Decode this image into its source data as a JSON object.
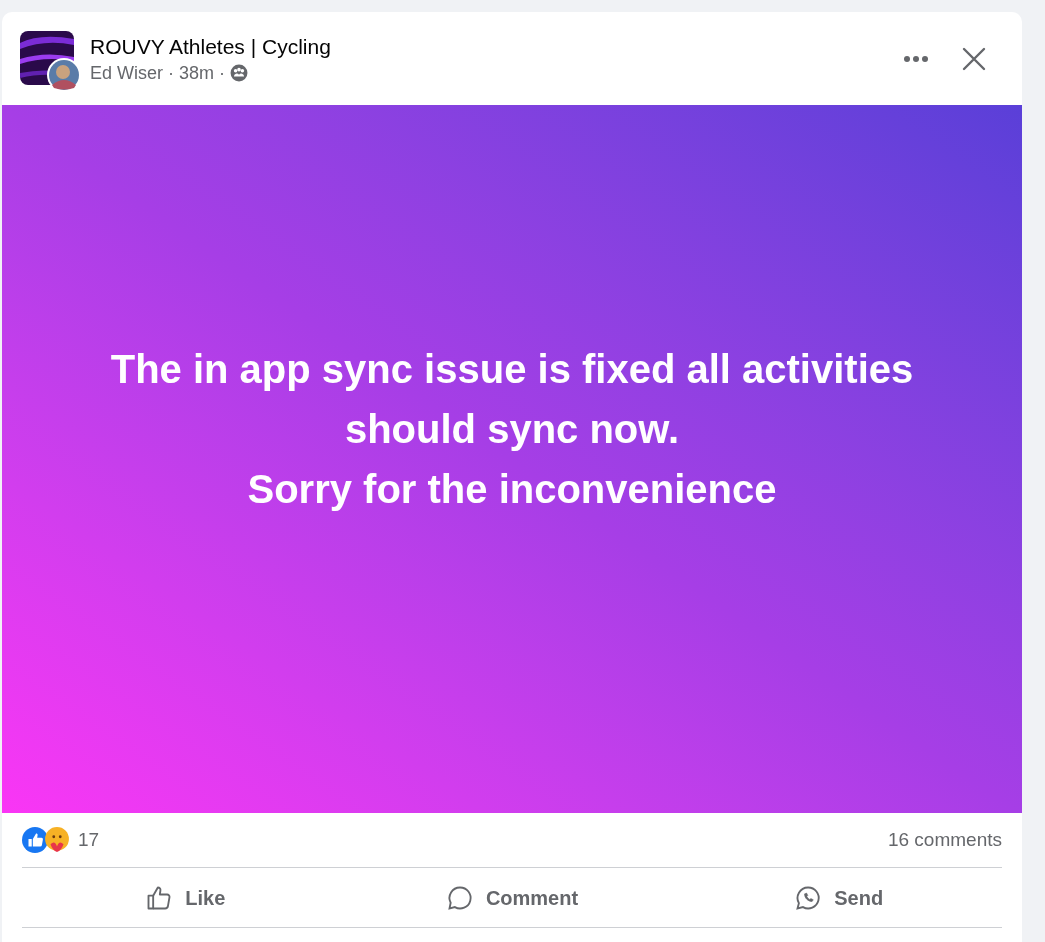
{
  "post": {
    "group": "ROUVY Athletes | Cycling",
    "author": "Ed Wiser",
    "time": "38m",
    "separator": "·",
    "lines": [
      "The in app sync issue is fixed all activities should sync now.",
      "Sorry for the inconvenience"
    ]
  },
  "stats": {
    "reactions": "17",
    "comments": "16 comments"
  },
  "actions": [
    {
      "kind": "like",
      "label": "Like"
    },
    {
      "kind": "comment",
      "label": "Comment"
    },
    {
      "kind": "send",
      "label": "Send"
    }
  ]
}
